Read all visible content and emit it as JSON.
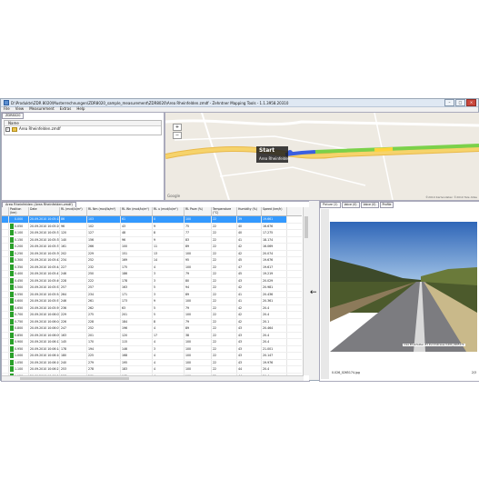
{
  "window": {
    "title": "D:\\Produkte\\ZDR 8020\\Musterrechnungen\\ZDR8020_sample_measurement\\ZDR8020\\Area Rheinfelden.zmdf - Zehntner Mapping Tools - 1.1.3958.20310",
    "min": "–",
    "max": "□",
    "close": "×"
  },
  "menu": [
    "File",
    "View",
    "Measurement",
    "Extras",
    "Help"
  ],
  "project": {
    "tab": "ZDR8020",
    "column_header": "Name",
    "file": "Area Rheinfelden.zmdf",
    "checked": "✓"
  },
  "map": {
    "callout_title": "Start",
    "callout_sub": "Area Rheinfelden",
    "zoom_in": "+",
    "zoom_out": "−",
    "brand": "Google",
    "copyright": "©2010 Kartendaten ©2010 Tele Atlas",
    "route_color": "#7bd14a",
    "road_color": "#f6d36b"
  },
  "table": {
    "doc_tab": "Area Rheinfelden (Area Rheinfelden.zmdf)",
    "headers": [
      "",
      "Position\n(km)",
      "Date",
      "RL\n(mcd/lx/m²)",
      "RL Nm\n(mcd/lx/m²)",
      "RL Wn\n(mcd/lx/m²)",
      "RL u\n(mcd/lx/m²)",
      "RL Pave\n(%)",
      "Temperature\n(°C)",
      "Humidity\n(%)",
      "Speed\n(km/h)"
    ],
    "rows": [
      {
        "sw": "#3399ff",
        "pos": "0.000",
        "date": "20.09.2010 10:05:15",
        "rl": "86",
        "nm": "103",
        "wn": "61",
        "u": "0",
        "pave": "100",
        "t": "22",
        "h": "39",
        "sp": "19.661"
      },
      {
        "sw": "#2aa02a",
        "pos": "0.050",
        "date": "20.09.2010 10:05:26",
        "rl": "96",
        "nm": "102",
        "wn": "43",
        "u": "9",
        "pave": "75",
        "t": "22",
        "h": "40",
        "sp": "16.676"
      },
      {
        "sw": "#2aa02a",
        "pos": "0.100",
        "date": "20.09.2010 10:05:31",
        "rl": "120",
        "nm": "127",
        "wn": "48",
        "u": "8",
        "pave": "77",
        "t": "22",
        "h": "40",
        "sp": "17.275"
      },
      {
        "sw": "#2aa02a",
        "pos": "0.150",
        "date": "20.09.2010 10:05:35",
        "rl": "140",
        "nm": "156",
        "wn": "96",
        "u": "9",
        "pave": "83",
        "t": "22",
        "h": "41",
        "sp": "18.174"
      },
      {
        "sw": "#2aa02a",
        "pos": "0.200",
        "date": "20.09.2010 10:05:37",
        "rl": "161",
        "nm": "266",
        "wn": "100",
        "u": "11",
        "pave": "89",
        "t": "22",
        "h": "42",
        "sp": "16.069"
      },
      {
        "sw": "#2aa02a",
        "pos": "0.250",
        "date": "20.09.2010 10:05:39",
        "rl": "202",
        "nm": "229",
        "wn": "151",
        "u": "13",
        "pave": "100",
        "t": "22",
        "h": "42",
        "sp": "20.074"
      },
      {
        "sw": "#2aa02a",
        "pos": "0.300",
        "date": "20.09.2010 10:05:42",
        "rl": "234",
        "nm": "252",
        "wn": "169",
        "u": "14",
        "pave": "95",
        "t": "22",
        "h": "45",
        "sp": "19.676"
      },
      {
        "sw": "#2aa02a",
        "pos": "0.350",
        "date": "20.09.2010 10:05:44",
        "rl": "227",
        "nm": "232",
        "wn": "175",
        "u": "4",
        "pave": "100",
        "t": "22",
        "h": "47",
        "sp": "19.617"
      },
      {
        "sw": "#2aa02a",
        "pos": "0.400",
        "date": "20.09.2010 10:05:47",
        "rl": "246",
        "nm": "250",
        "wn": "186",
        "u": "3",
        "pave": "79",
        "t": "22",
        "h": "45",
        "sp": "19.219"
      },
      {
        "sw": "#2aa02a",
        "pos": "0.450",
        "date": "20.09.2010 10:05:49",
        "rl": "228",
        "nm": "222",
        "wn": "178",
        "u": "3",
        "pave": "80",
        "t": "22",
        "h": "43",
        "sp": "20.029"
      },
      {
        "sw": "#2aa02a",
        "pos": "0.500",
        "date": "20.09.2010 10:05:52",
        "rl": "257",
        "nm": "257",
        "wn": "163",
        "u": "5",
        "pave": "94",
        "t": "22",
        "h": "42",
        "sp": "20.981"
      },
      {
        "sw": "#2aa02a",
        "pos": "0.550",
        "date": "20.09.2010 10:05:54",
        "rl": "264",
        "nm": "234",
        "wn": "171",
        "u": "3",
        "pave": "89",
        "t": "22",
        "h": "41",
        "sp": "20.436"
      },
      {
        "sw": "#2aa02a",
        "pos": "0.600",
        "date": "20.09.2010 10:05:57",
        "rl": "246",
        "nm": "261",
        "wn": "173",
        "u": "9",
        "pave": "100",
        "t": "22",
        "h": "41",
        "sp": "20.361"
      },
      {
        "sw": "#2aa02a",
        "pos": "0.650",
        "date": "20.09.2010 10:05:59",
        "rl": "236",
        "nm": "262",
        "wn": "63",
        "u": "5",
        "pave": "79",
        "t": "22",
        "h": "42",
        "sp": "20.4"
      },
      {
        "sw": "#2aa02a",
        "pos": "0.700",
        "date": "20.09.2010 10:06:02",
        "rl": "229",
        "nm": "275",
        "wn": "201",
        "u": "5",
        "pave": "100",
        "t": "22",
        "h": "42",
        "sp": "20.4"
      },
      {
        "sw": "#2aa02a",
        "pos": "0.750",
        "date": "20.09.2010 10:06:04",
        "rl": "226",
        "nm": "228",
        "wn": "184",
        "u": "8",
        "pave": "79",
        "t": "22",
        "h": "42",
        "sp": "20.1"
      },
      {
        "sw": "#2aa02a",
        "pos": "0.800",
        "date": "20.09.2010 10:06:07",
        "rl": "247",
        "nm": "252",
        "wn": "196",
        "u": "4",
        "pave": "89",
        "t": "22",
        "h": "43",
        "sp": "20.464"
      },
      {
        "sw": "#2aa02a",
        "pos": "0.850",
        "date": "20.09.2010 10:06:09",
        "rl": "163",
        "nm": "201",
        "wn": "120",
        "u": "17",
        "pave": "38",
        "t": "22",
        "h": "43",
        "sp": "20.4"
      },
      {
        "sw": "#2aa02a",
        "pos": "0.900",
        "date": "20.09.2010 10:06:12",
        "rl": "145",
        "nm": "170",
        "wn": "115",
        "u": "4",
        "pave": "100",
        "t": "22",
        "h": "43",
        "sp": "20.4"
      },
      {
        "sw": "#2aa02a",
        "pos": "0.950",
        "date": "20.09.2010 10:06:14",
        "rl": "178",
        "nm": "194",
        "wn": "146",
        "u": "3",
        "pave": "100",
        "t": "22",
        "h": "43",
        "sp": "21.001"
      },
      {
        "sw": "#2aa02a",
        "pos": "1.000",
        "date": "20.09.2010 10:06:16",
        "rl": "180",
        "nm": "225",
        "wn": "168",
        "u": "4",
        "pave": "100",
        "t": "22",
        "h": "43",
        "sp": "20.147"
      },
      {
        "sw": "#2aa02a",
        "pos": "1.050",
        "date": "20.09.2010 10:06:19",
        "rl": "240",
        "nm": "279",
        "wn": "195",
        "u": "4",
        "pave": "100",
        "t": "22",
        "h": "43",
        "sp": "19.976"
      },
      {
        "sw": "#2aa02a",
        "pos": "1.100",
        "date": "20.09.2010 10:06:21",
        "rl": "253",
        "nm": "278",
        "wn": "183",
        "u": "4",
        "pave": "100",
        "t": "22",
        "h": "44",
        "sp": "20.4"
      },
      {
        "sw": "#2aa02a",
        "pos": "1.150",
        "date": "20.09.2010 10:06:24",
        "rl": "237",
        "nm": "261",
        "wn": "162",
        "u": "4",
        "pave": "100",
        "t": "22",
        "h": "44",
        "sp": "20.4"
      },
      {
        "sw": "#2aa02a",
        "pos": "1.200",
        "date": "20.09.2010 10:06:26",
        "rl": "249",
        "nm": "268",
        "wn": "170",
        "u": "4",
        "pave": "100",
        "t": "22",
        "h": "44",
        "sp": "20.466"
      },
      {
        "sw": "#2aa02a",
        "pos": "1.250",
        "date": "20.09.2010 10:06:29",
        "rl": "252",
        "nm": "271",
        "wn": "185",
        "u": "4",
        "pave": "100",
        "t": "22",
        "h": "44",
        "sp": "20.4"
      },
      {
        "sw": "#2aa02a",
        "pos": "1.300",
        "date": "20.09.2010 10:06:31",
        "rl": "262",
        "nm": "291",
        "wn": "177",
        "u": "4",
        "pave": "100",
        "t": "22",
        "h": "44",
        "sp": "20.4"
      }
    ]
  },
  "picture": {
    "tabs": [
      "Picture (2)",
      "Voice (0)",
      "Voice (0)",
      "Profile"
    ],
    "caption": "Area Rheinfelden #2   Zurichstrasse   0,000_0265174",
    "filename": "0.026_0265174.jpg",
    "counter": "2/3",
    "nav_arrow": "←"
  }
}
